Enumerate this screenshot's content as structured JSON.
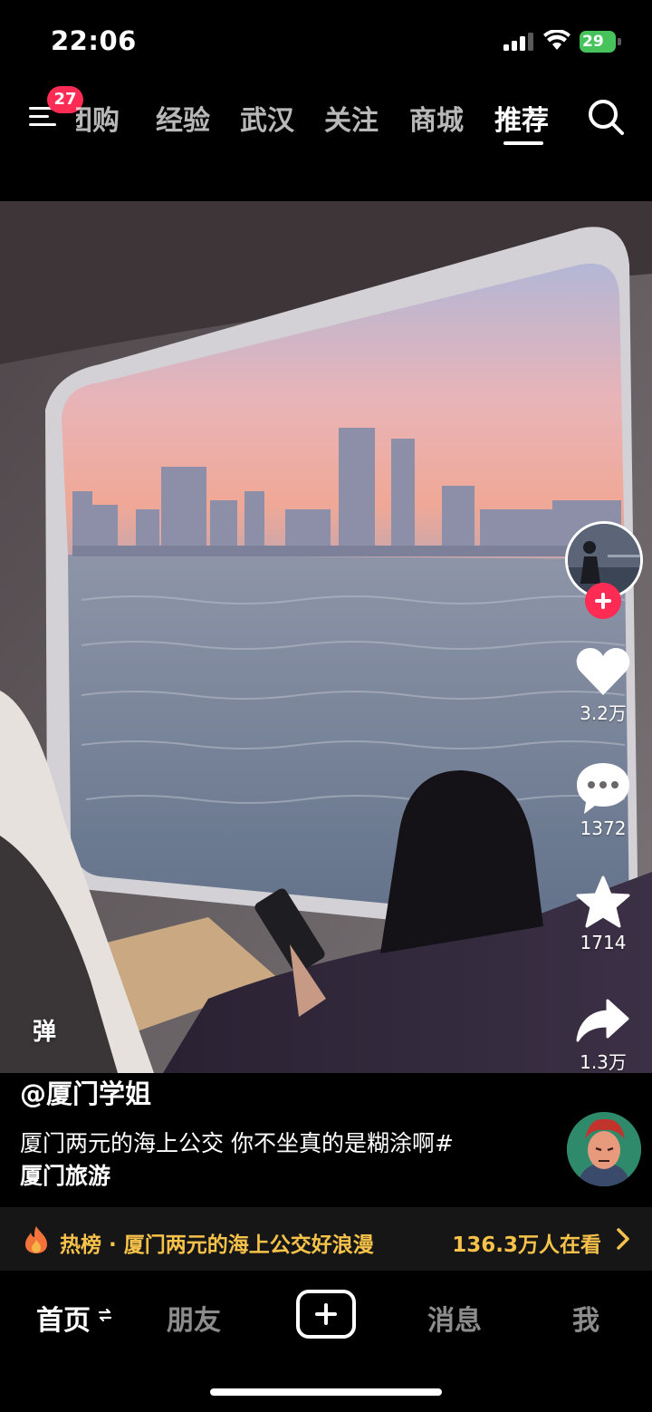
{
  "status_bar": {
    "time": "22:06",
    "battery": "29",
    "icons": [
      "signal-icon",
      "wifi-icon",
      "battery-icon"
    ]
  },
  "top_nav": {
    "badge": "27",
    "tabs": [
      "团购",
      "经验",
      "武汉",
      "关注",
      "商城",
      "推荐"
    ],
    "active_tab": "推荐",
    "icons": [
      "menu-icon",
      "search-icon"
    ]
  },
  "video": {
    "scene": "ferry-window-city-skyline",
    "danmaku_label": "弹"
  },
  "actions": {
    "like_count": "3.2万",
    "comment_count": "1372",
    "favorite_count": "1714",
    "share_count": "1.3万",
    "icons": [
      "heart-icon",
      "comment-icon",
      "star-icon",
      "share-icon",
      "plus-icon"
    ]
  },
  "caption": {
    "author": "@厦门学姐",
    "description_line1": "厦门两元的海上公交 你不坐真的是糊涂啊#",
    "hashtag": "厦门旅游"
  },
  "hot_bar": {
    "text": "热榜 · 厦门两元的海上公交好浪漫",
    "watching": "136.3万人在看",
    "icons": [
      "flame-icon",
      "chevron-right-icon"
    ]
  },
  "bottom_nav": {
    "home": "首页",
    "friends": "朋友",
    "messages": "消息",
    "me": "我",
    "icons": [
      "refresh-icon",
      "create-plus-icon"
    ]
  },
  "colors": {
    "accent_red": "#fe2c55",
    "hot_gold": "#f6c24a",
    "battery_green": "#46c35a"
  }
}
